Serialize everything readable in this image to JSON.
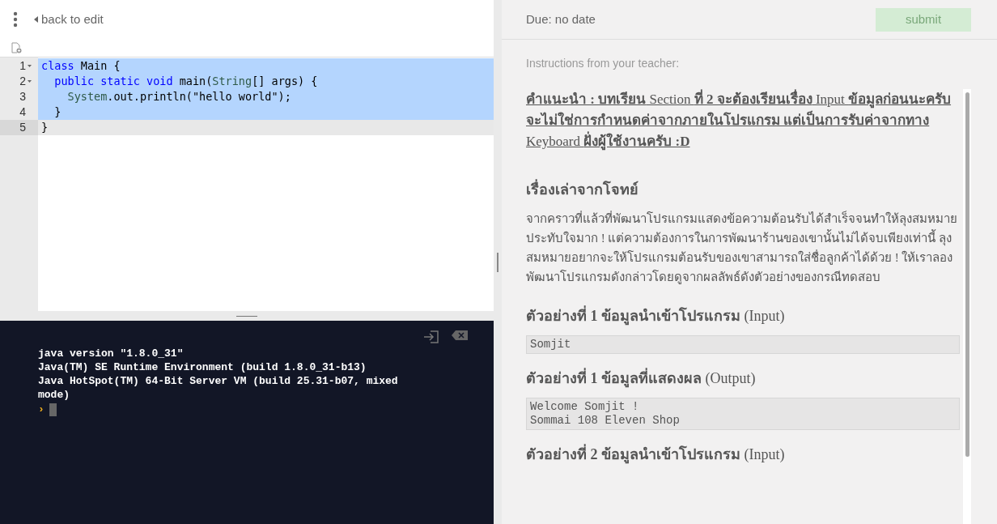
{
  "toolbar": {
    "back_link": "back to edit"
  },
  "editor": {
    "lines": [
      {
        "number": "1",
        "foldable": true,
        "selected": true,
        "current": false,
        "tokens": [
          {
            "text": "class",
            "kind": "keyword"
          },
          {
            "text": " Main {",
            "kind": "plain"
          }
        ]
      },
      {
        "number": "2",
        "foldable": true,
        "selected": true,
        "current": false,
        "tokens": [
          {
            "text": "  public static void",
            "kind": "keyword"
          },
          {
            "text": " main(",
            "kind": "plain"
          },
          {
            "text": "String",
            "kind": "type"
          },
          {
            "text": "[] args) {",
            "kind": "plain"
          }
        ]
      },
      {
        "number": "3",
        "foldable": false,
        "selected": true,
        "current": false,
        "tokens": [
          {
            "text": "    System",
            "kind": "type"
          },
          {
            "text": ".out.println(\"hello world\");",
            "kind": "plain"
          }
        ]
      },
      {
        "number": "4",
        "foldable": false,
        "selected": true,
        "current": false,
        "tokens": [
          {
            "text": "  }",
            "kind": "plain"
          }
        ]
      },
      {
        "number": "5",
        "foldable": false,
        "selected": false,
        "current": true,
        "tokens": [
          {
            "text": "}",
            "kind": "plain"
          }
        ]
      }
    ]
  },
  "console": {
    "lines": [
      "java version \"1.8.0_31\"",
      "Java(TM) SE Runtime Environment (build 1.8.0_31-b13)",
      "Java HotSpot(TM) 64-Bit Server VM (build 25.31-b07, mixed mode)"
    ],
    "prompt": "›"
  },
  "assignment": {
    "due": "Due: no date",
    "submit": "submit",
    "instructions_label": "Instructions from your teacher:",
    "blocks": [
      {
        "kind": "note",
        "text": "**คำแนะนำ : บทเรียน** Section **ที่ 2 จะต้องเรียนเรื่อง** Input **ข้อมูลก่อนนะครับ จะไม่ใช่การกำหนดค่าจากภายในโปรแกรม แต่เป็นการรับค่าจากทาง** Keyboard **ฝั่งผู้ใช้งานครับ :D**"
      },
      {
        "kind": "heading",
        "text": "**เรื่องเล่าจากโจทย์**"
      },
      {
        "kind": "paragraph",
        "text": " จากคราวที่แล้วที่พัฒนาโปรแกรมแสดงข้อความต้อนรับได้สำเร็จจนทำให้ลุงสมหมายประทับใจมาก ! แต่ความต้องการในการพัฒนาร้านของเขานั้นไม่ได้จบเพียงเท่านี้ ลุงสมหมายอยากจะให้โปรแกรมต้อนรับของเขาสามารถใส่ชื่อลูกค้าได้ด้วย ! ให้เราลองพัฒนาโปรแกรมดังกล่าวโดยดูจากผลลัพธ์ดังตัวอย่างของกรณีทดสอบ"
      },
      {
        "kind": "heading",
        "text": "**ตัวอย่างที่ 1 ข้อมูลนำเข้าโปรแกรม** (Input)"
      },
      {
        "kind": "sample",
        "text": "Somjit"
      },
      {
        "kind": "heading",
        "text": "**ตัวอย่างที่ 1 ข้อมูลที่แสดงผล** (Output)"
      },
      {
        "kind": "sample",
        "text": "Welcome Somjit !\nSommai 108 Eleven Shop"
      },
      {
        "kind": "heading",
        "text": "**ตัวอย่างที่ 2 ข้อมูลนำเข้าโปรแกรม** (Input)"
      }
    ]
  }
}
